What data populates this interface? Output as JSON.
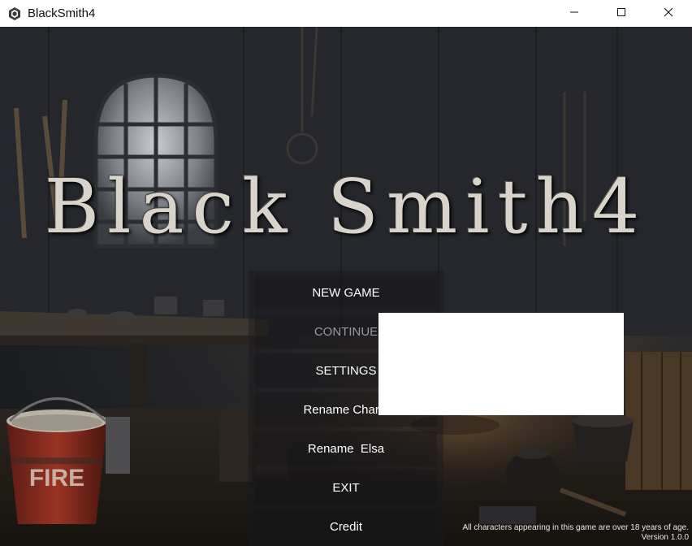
{
  "window": {
    "title": "BlackSmith4",
    "icon": "app-cube-icon",
    "controls": [
      "minimize-icon",
      "maximize-icon",
      "close-icon"
    ]
  },
  "game": {
    "title": "Black Smith4"
  },
  "menu": {
    "new_game": "NEW GAME",
    "continue": "CONTINUE",
    "settings": "SETTINGS",
    "rename_charlotte": "Rename Charlo",
    "rename_elsa": "Rename  Elsa",
    "exit": "EXIT",
    "credit": "Credit"
  },
  "footer": {
    "disclaimer": "All characters appearing in this game are over 18 years of age.",
    "version": "Version 1.0.0"
  },
  "bucket": {
    "label": "FIRE"
  },
  "colors": {
    "titlebar_bg": "#ffffff",
    "menu_text": "#ffffff",
    "menu_disabled_text": "#9a9a9a",
    "scene_dark": "#1b1d21",
    "bucket_red": "#8b2a1e"
  }
}
